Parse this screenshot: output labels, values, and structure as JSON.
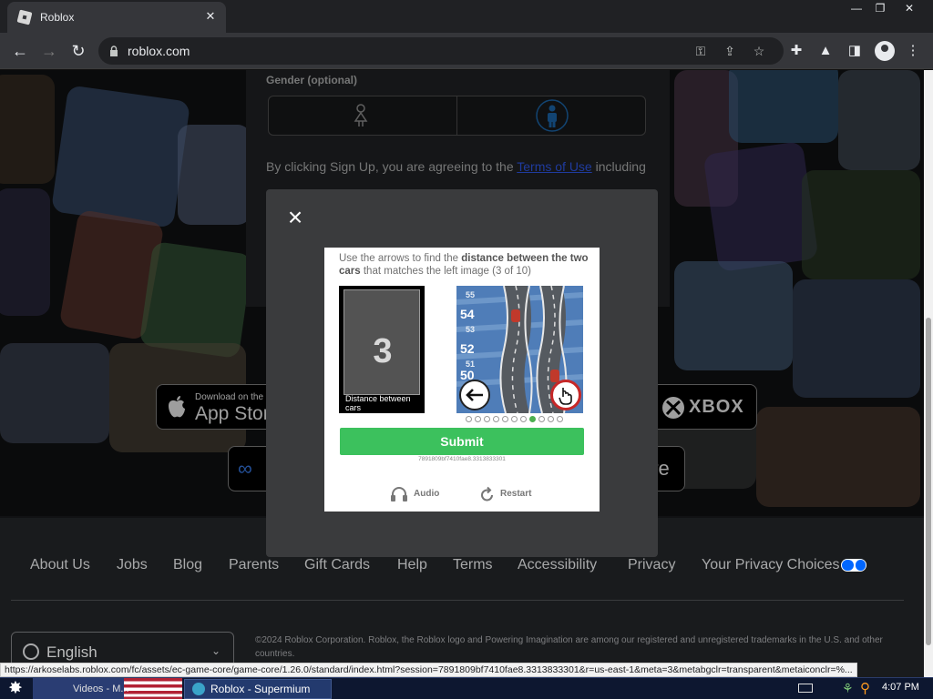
{
  "browser": {
    "tab_title": "Roblox",
    "tab_close": "✕",
    "window_controls": [
      "—",
      "❐",
      "✕"
    ],
    "url": "roblox.com"
  },
  "signup": {
    "gender_label": "Gender (optional)",
    "terms_prefix": "By clicking Sign Up, you are agreeing to the ",
    "terms_link": "Terms of Use",
    "terms_suffix": " including"
  },
  "stores": {
    "app_store_small": "Download on the",
    "app_store_big": "App Stor",
    "xbox": "XBOX",
    "partial_store": "ore"
  },
  "captcha": {
    "instruction_pre": "Use the arrows to find the ",
    "instruction_bold": "distance between the two cars",
    "instruction_post": " that matches the left image (3 of 10)",
    "reference_number": "3",
    "reference_caption": "Distance between cars",
    "road_numbers": [
      "55",
      "54",
      "53",
      "52",
      "51",
      "50"
    ],
    "dot_count": 11,
    "active_dot": 7,
    "submit": "Submit",
    "session": "7891809bf7410fae8.3313833301",
    "audio": "Audio",
    "restart": "Restart"
  },
  "footer": {
    "links": [
      "About Us",
      "Jobs",
      "Blog",
      "Parents",
      "Gift Cards",
      "Help",
      "Terms",
      "Accessibility",
      "Privacy",
      "Your Privacy Choices"
    ],
    "language": "English",
    "copyright": "©2024 Roblox Corporation. Roblox, the Roblox logo and Powering Imagination are among our registered and unregistered trademarks in the U.S. and other countries."
  },
  "status_url": "https://arkoselabs.roblox.com/fc/assets/ec-game-core/game-core/1.26.0/standard/index.html?session=7891809bf7410fae8.3313833301&r=us-east-1&meta=3&metabgclr=transparent&metaiconclr=%...",
  "taskbar": {
    "videos_label": "Videos - M...",
    "active_window": "Roblox - Supermium",
    "clock": "4:07 PM"
  },
  "colors": {
    "submit_green": "#3cc15d",
    "link_blue": "#335fff",
    "modal_bg": "#3a3b3d"
  }
}
